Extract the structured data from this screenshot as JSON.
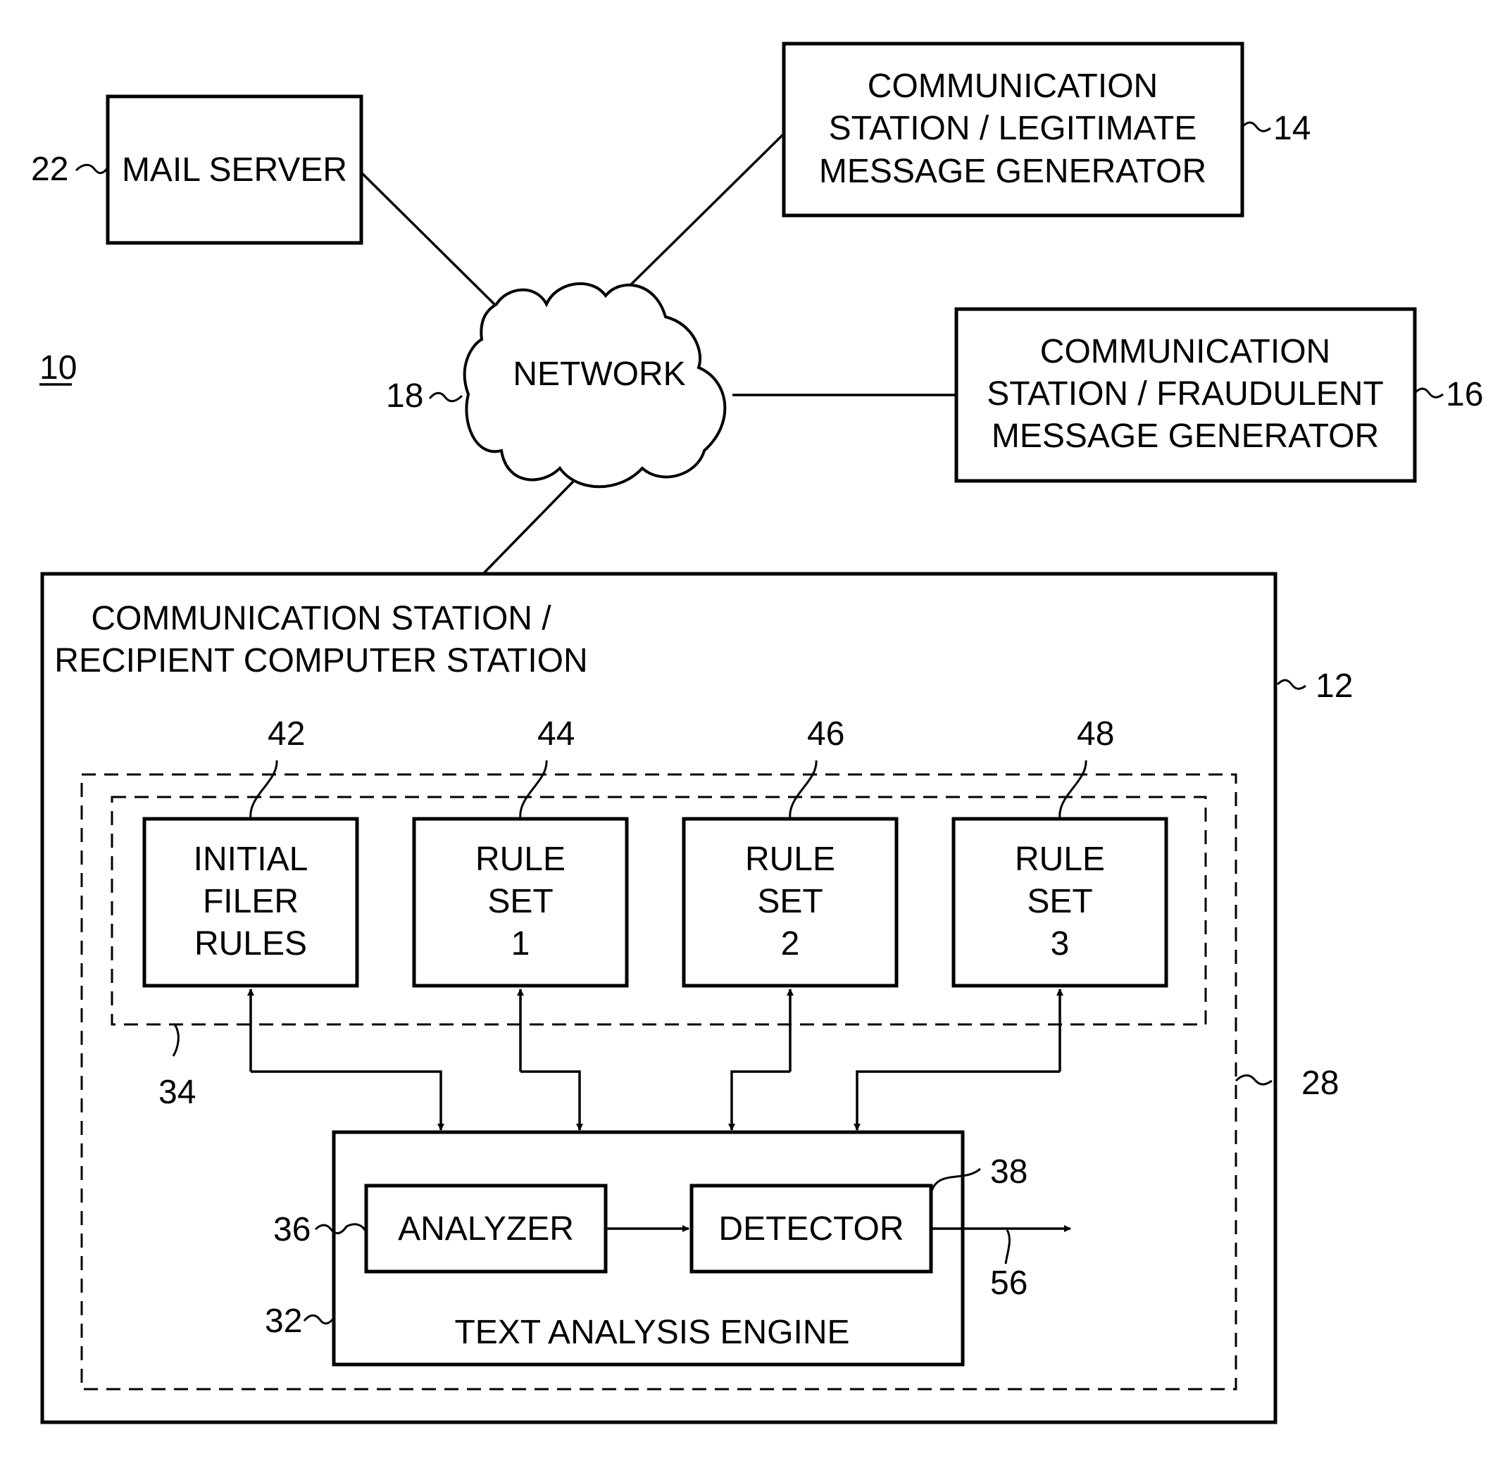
{
  "figure": {
    "figure_ref": "10",
    "nodes": {
      "mail_server": {
        "ref": "22",
        "lines": [
          "MAIL SERVER"
        ]
      },
      "legit_station": {
        "ref": "14",
        "lines": [
          "COMMUNICATION",
          "STATION / LEGITIMATE",
          "MESSAGE GENERATOR"
        ]
      },
      "network": {
        "ref": "18",
        "lines": [
          "NETWORK"
        ]
      },
      "fraud_station": {
        "ref": "16",
        "lines": [
          "COMMUNICATION",
          "STATION / FRAUDULENT",
          "MESSAGE GENERATOR"
        ]
      },
      "recipient_station": {
        "ref": "12",
        "lines": [
          "COMMUNICATION STATION /",
          "RECIPIENT COMPUTER STATION"
        ]
      },
      "outer_dashed": {
        "ref": "28"
      },
      "rules_group": {
        "ref": "34"
      },
      "initial_rules": {
        "ref": "42",
        "lines": [
          "INITIAL",
          "FILER",
          "RULES"
        ]
      },
      "rule_set_1": {
        "ref": "44",
        "lines": [
          "RULE",
          "SET",
          "1"
        ]
      },
      "rule_set_2": {
        "ref": "46",
        "lines": [
          "RULE",
          "SET",
          "2"
        ]
      },
      "rule_set_3": {
        "ref": "48",
        "lines": [
          "RULE",
          "SET",
          "3"
        ]
      },
      "text_engine": {
        "ref": "32",
        "lines": [
          "TEXT ANALYSIS ENGINE"
        ]
      },
      "analyzer": {
        "ref": "36",
        "lines": [
          "ANALYZER"
        ]
      },
      "detector": {
        "ref": "38",
        "lines": [
          "DETECTOR"
        ]
      },
      "output": {
        "ref": "56"
      }
    }
  }
}
